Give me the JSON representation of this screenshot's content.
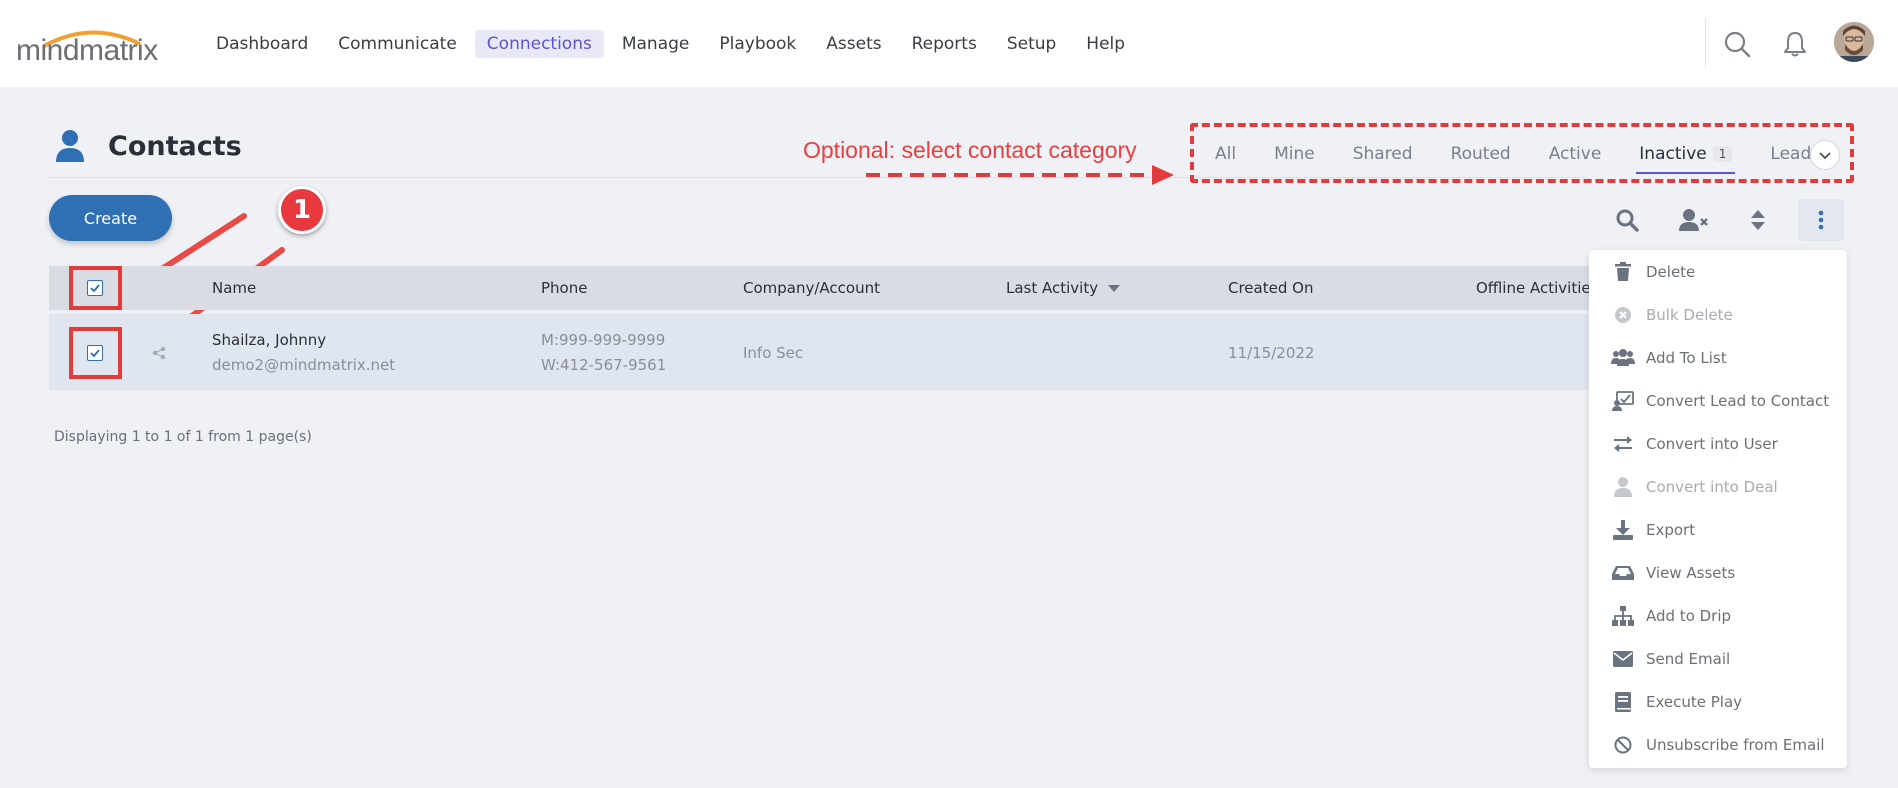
{
  "app": {
    "logo_text": "mindmatrix"
  },
  "nav": {
    "items": [
      {
        "label": "Dashboard",
        "active": false
      },
      {
        "label": "Communicate",
        "active": false
      },
      {
        "label": "Connections",
        "active": true
      },
      {
        "label": "Manage",
        "active": false
      },
      {
        "label": "Playbook",
        "active": false
      },
      {
        "label": "Assets",
        "active": false
      },
      {
        "label": "Reports",
        "active": false
      },
      {
        "label": "Setup",
        "active": false
      },
      {
        "label": "Help",
        "active": false
      }
    ]
  },
  "page": {
    "title": "Contacts",
    "annotation": "Optional: select contact category",
    "step_number": "1"
  },
  "tabs": {
    "items": [
      {
        "label": "All",
        "active": false,
        "count": ""
      },
      {
        "label": "Mine",
        "active": false,
        "count": ""
      },
      {
        "label": "Shared",
        "active": false,
        "count": ""
      },
      {
        "label": "Routed",
        "active": false,
        "count": ""
      },
      {
        "label": "Active",
        "active": false,
        "count": ""
      },
      {
        "label": "Inactive",
        "active": true,
        "count": "1"
      },
      {
        "label": "Leads",
        "active": false,
        "count": ""
      }
    ]
  },
  "toolbar": {
    "create_label": "Create"
  },
  "table": {
    "columns": [
      "Name",
      "Phone",
      "Company/Account",
      "Last Activity",
      "Created On",
      "Offline Activitie"
    ],
    "rows": [
      {
        "name": "Shailza, Johnny",
        "email": "demo2@mindmatrix.net",
        "phone_mobile": "M:999-999-9999",
        "phone_work": "W:412-567-9561",
        "company": "Info Sec",
        "last_activity": "",
        "created_on": "11/15/2022"
      }
    ],
    "footer": "Displaying 1 to 1 of 1 from 1 page(s)"
  },
  "menu": {
    "items": [
      {
        "label": "Delete",
        "icon": "trash-icon",
        "disabled": false
      },
      {
        "label": "Bulk Delete",
        "icon": "x-circle-icon",
        "disabled": true
      },
      {
        "label": "Add To List",
        "icon": "users-icon",
        "disabled": false
      },
      {
        "label": "Convert Lead to Contact",
        "icon": "convert-icon",
        "disabled": false
      },
      {
        "label": "Convert into User",
        "icon": "swap-arrows-icon",
        "disabled": false
      },
      {
        "label": "Convert into Deal",
        "icon": "user-icon",
        "disabled": true
      },
      {
        "label": "Export",
        "icon": "download-icon",
        "disabled": false
      },
      {
        "label": "View Assets",
        "icon": "inbox-icon",
        "disabled": false
      },
      {
        "label": "Add to Drip",
        "icon": "sitemap-icon",
        "disabled": false
      },
      {
        "label": "Send Email",
        "icon": "envelope-icon",
        "disabled": false
      },
      {
        "label": "Execute Play",
        "icon": "book-icon",
        "disabled": false
      },
      {
        "label": "Unsubscribe from Email",
        "icon": "ban-icon",
        "disabled": false
      }
    ]
  },
  "colors": {
    "accent": "#5a55d4",
    "primary": "#2f6fb3",
    "annotation": "#e23b3b"
  }
}
